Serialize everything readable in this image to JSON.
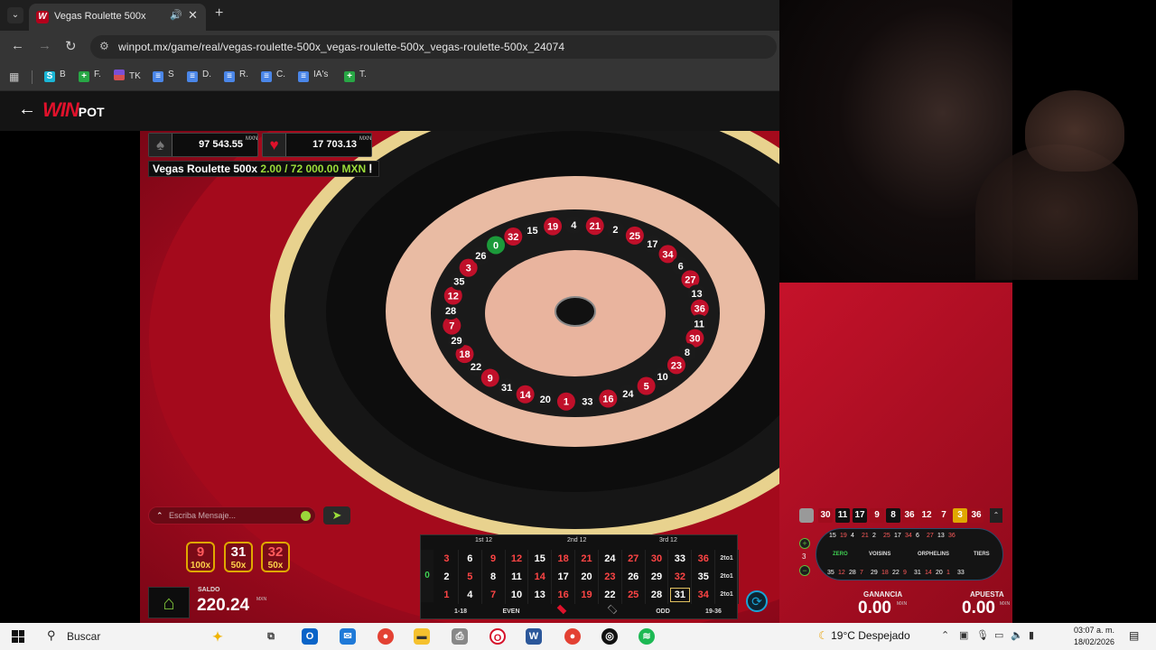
{
  "browser": {
    "tab_title": "Vegas Roulette 500x",
    "url": "winpot.mx/game/real/vegas-roulette-500x_vegas-roulette-500x_vegas-roulette-500x_24074",
    "bookmarks": [
      {
        "label": "B",
        "icon": "blue"
      },
      {
        "label": "F.",
        "icon": "sheet"
      },
      {
        "label": "TK",
        "icon": "flag"
      },
      {
        "label": "S",
        "icon": "doc"
      },
      {
        "label": "D.",
        "icon": "doc"
      },
      {
        "label": "R.",
        "icon": "doc"
      },
      {
        "label": "C.",
        "icon": "doc"
      },
      {
        "label": "IA's",
        "icon": "doc"
      },
      {
        "label": "T.",
        "icon": "sheet"
      }
    ]
  },
  "site": {
    "logo": "WIN",
    "logo_suffix": "POT"
  },
  "game": {
    "stats": [
      {
        "symbol": "♠",
        "value": "97 543.55",
        "currency": "MXN"
      },
      {
        "symbol": "♥",
        "value": "17 703.13",
        "currency": "MXN"
      }
    ],
    "limit_name": "Vegas Roulette 500x",
    "limit_range": "2.00 / 72 000.00 MXN",
    "chat_placeholder": "Escriba Mensaje...",
    "multipliers": [
      {
        "number": "9",
        "mult": "100x",
        "color": "red"
      },
      {
        "number": "31",
        "mult": "50x",
        "color": "black"
      },
      {
        "number": "32",
        "mult": "50x",
        "color": "red"
      }
    ],
    "saldo_label": "SALDO",
    "saldo": "220.24",
    "ganancia_label": "GANANCIA",
    "ganancia": "0.00",
    "apuesta_label": "APUESTA",
    "apuesta": "0.00",
    "currency": "MXN",
    "wheel_numbers": [
      "0",
      "32",
      "15",
      "19",
      "4",
      "21",
      "2",
      "25",
      "17",
      "34",
      "6",
      "27",
      "13",
      "36",
      "11",
      "30",
      "8",
      "23",
      "10",
      "5",
      "24",
      "16",
      "33",
      "1",
      "20",
      "14",
      "31",
      "9",
      "22",
      "18",
      "29",
      "7",
      "28",
      "12",
      "35",
      "3",
      "26"
    ],
    "table": {
      "dozens": [
        "1st 12",
        "2nd 12",
        "3rd 12"
      ],
      "zero": "0",
      "rows": [
        [
          "3",
          "6",
          "9",
          "12",
          "15",
          "18",
          "21",
          "24",
          "27",
          "30",
          "33",
          "36",
          "2to1"
        ],
        [
          "2",
          "5",
          "8",
          "11",
          "14",
          "17",
          "20",
          "23",
          "26",
          "29",
          "32",
          "35",
          "2to1"
        ],
        [
          "1",
          "4",
          "7",
          "10",
          "13",
          "16",
          "19",
          "22",
          "25",
          "28",
          "31",
          "34",
          "2to1"
        ]
      ],
      "outside": [
        "1-18",
        "EVEN",
        "",
        "",
        "ODD",
        "19-36"
      ]
    },
    "history": [
      {
        "n": "30",
        "c": "r"
      },
      {
        "n": "11",
        "c": "b"
      },
      {
        "n": "17",
        "c": "b"
      },
      {
        "n": "9",
        "c": "r"
      },
      {
        "n": "8",
        "c": "b"
      },
      {
        "n": "36",
        "c": "r"
      },
      {
        "n": "12",
        "c": "r"
      },
      {
        "n": "7",
        "c": "r"
      },
      {
        "n": "3",
        "c": "y"
      },
      {
        "n": "36",
        "c": "r"
      }
    ],
    "racetrack": {
      "sections": [
        "ZERO",
        "VOISINS",
        "ORPHELINS",
        "TIERS"
      ],
      "neighbours": "3",
      "top": [
        "15",
        "19",
        "4",
        "21",
        "2",
        "25",
        "17",
        "34",
        "6",
        "27",
        "13",
        "36"
      ],
      "bottom": [
        "35",
        "12",
        "28",
        "7",
        "29",
        "18",
        "22",
        "9",
        "31",
        "14",
        "20",
        "1",
        "33"
      ]
    }
  },
  "taskbar": {
    "search_label": "Buscar",
    "weather": "19°C  Despejado",
    "time": "03:07 a. m.",
    "date": "18/02/2026"
  }
}
